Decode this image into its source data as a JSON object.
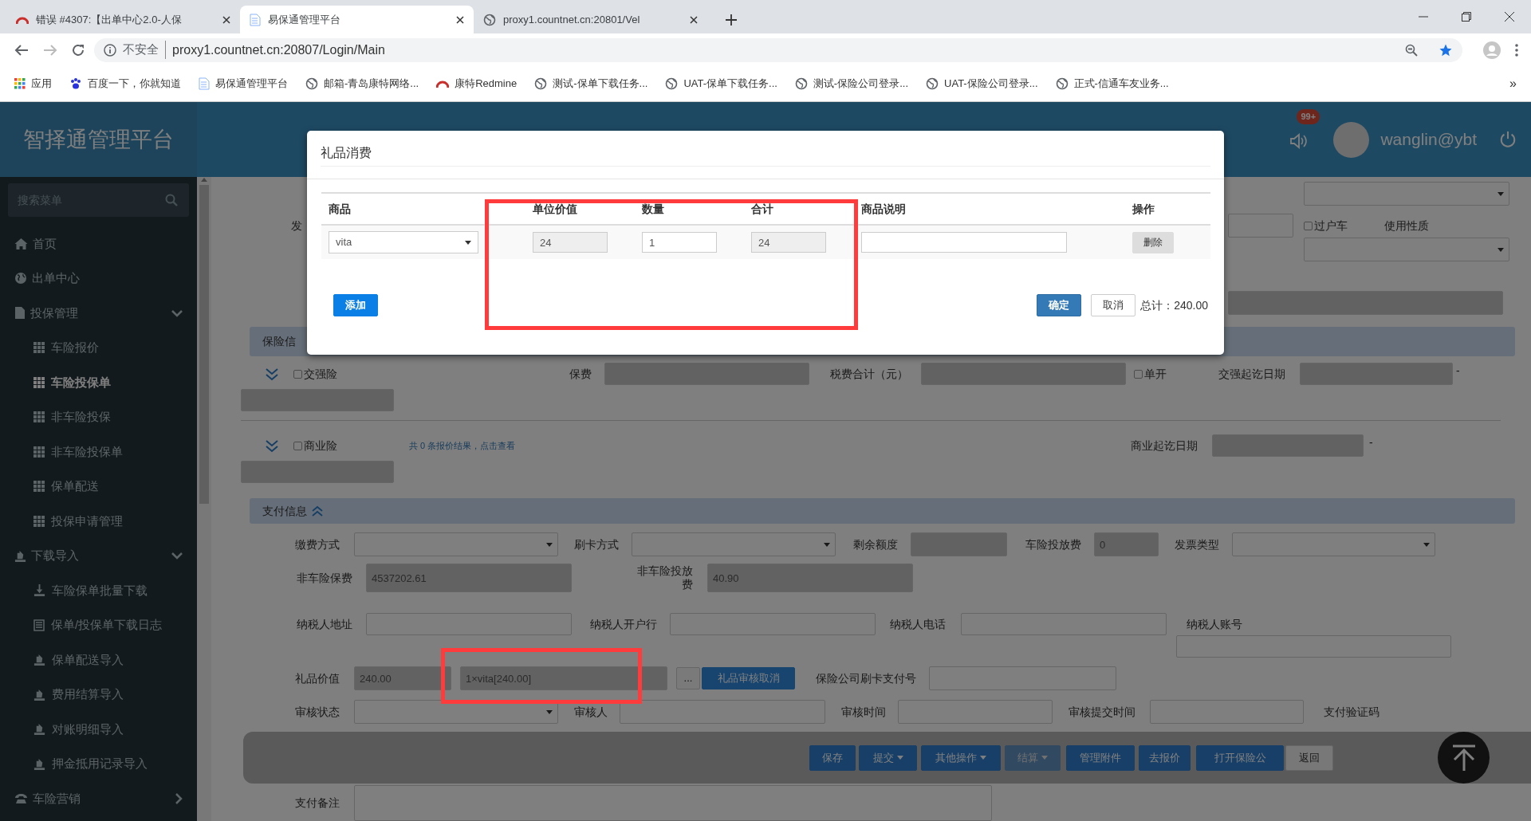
{
  "browser": {
    "tabs": [
      {
        "title": "错误 #4307:【出单中心2.0-人保",
        "selected": false
      },
      {
        "title": "易保通管理平台",
        "selected": true
      },
      {
        "title": "proxy1.countnet.cn:20801/Vel",
        "selected": false
      }
    ],
    "security": "不安全",
    "url": "proxy1.countnet.cn:20807/Login/Main",
    "bookmarks": [
      "应用",
      "百度一下，你就知道",
      "易保通管理平台",
      "邮箱-青岛康特网络...",
      "康特Redmine",
      "测试-保单下载任务...",
      "UAT-保单下载任务...",
      "测试-保险公司登录...",
      "UAT-保险公司登录...",
      "正式-信通车友业务..."
    ],
    "bookmarks_more": "»"
  },
  "header": {
    "title": "智择通管理平台",
    "badge": "99+",
    "user": "wanglin@ybt"
  },
  "sidebar": {
    "search": {
      "placeholder": "搜索菜单"
    },
    "items": [
      {
        "label": "首页",
        "selected": false
      },
      {
        "label": "出单中心",
        "selected": false
      },
      {
        "label": "投保管理",
        "selected": false,
        "expanded": true,
        "children": [
          {
            "label": "车险报价",
            "selected": false
          },
          {
            "label": "车险投保单",
            "selected": true
          },
          {
            "label": "非车险投保",
            "selected": false
          },
          {
            "label": "非车险投保单",
            "selected": false
          },
          {
            "label": "保单配送",
            "selected": false
          },
          {
            "label": "投保申请管理",
            "selected": false
          }
        ]
      },
      {
        "label": "下载导入",
        "selected": false,
        "expanded": true,
        "children": [
          {
            "label": "车险保单批量下载",
            "selected": false
          },
          {
            "label": "保单/投保单下载日志",
            "selected": false
          },
          {
            "label": "保单配送导入",
            "selected": false
          },
          {
            "label": "费用结算导入",
            "selected": false
          },
          {
            "label": "对账明细导入",
            "selected": false
          },
          {
            "label": "押金抵用记录导入",
            "selected": false
          }
        ]
      },
      {
        "label": "车险营销",
        "selected": false,
        "expanded": false
      }
    ]
  },
  "form": {
    "rows": [
      {
        "kind": "fields",
        "items": [
          {
            "kind": "select"
          }
        ]
      },
      {
        "kind": "fields",
        "items": [
          {
            "kind": "label",
            "text": "发"
          },
          {
            "kind": "input",
            "readonly": false
          },
          {
            "kind": "checkbox",
            "label": "过户车",
            "checked": false
          },
          {
            "kind": "label",
            "text": "使用性质"
          }
        ]
      },
      {
        "kind": "fields",
        "items": [
          {
            "kind": "select"
          }
        ]
      },
      {
        "kind": "fields",
        "items": [
          {
            "kind": "input",
            "readonly": true
          }
        ]
      },
      {
        "kind": "section",
        "title": "保险信"
      },
      {
        "kind": "fields",
        "items": [
          {
            "kind": "toggle"
          },
          {
            "kind": "checkbox",
            "label": "交强险",
            "checked": false
          },
          {
            "kind": "label",
            "text": "保费"
          },
          {
            "kind": "input",
            "readonly": true
          },
          {
            "kind": "label",
            "text": "税费合计（元）"
          },
          {
            "kind": "input",
            "readonly": true
          },
          {
            "kind": "checkbox",
            "label": "单开",
            "checked": false
          },
          {
            "kind": "label",
            "text": "交强起讫日期"
          },
          {
            "kind": "input",
            "readonly": true
          },
          {
            "kind": "text",
            "text": "-"
          }
        ]
      },
      {
        "kind": "fields",
        "items": [
          {
            "kind": "input",
            "readonly": true
          }
        ]
      },
      {
        "kind": "divider"
      },
      {
        "kind": "fields",
        "items": [
          {
            "kind": "toggle"
          },
          {
            "kind": "checkbox",
            "label": "商业险",
            "checked": false
          },
          {
            "kind": "link",
            "text": "共 0 条报价结果，点击查看"
          },
          {
            "kind": "label",
            "text": "商业起讫日期"
          },
          {
            "kind": "input",
            "readonly": true
          },
          {
            "kind": "text",
            "text": "-"
          }
        ]
      },
      {
        "kind": "fields",
        "items": [
          {
            "kind": "input",
            "readonly": true
          }
        ]
      },
      {
        "kind": "section",
        "title": "支付信息",
        "expanded": true
      },
      {
        "kind": "fields",
        "items": [
          {
            "kind": "label",
            "text": "缴费方式"
          },
          {
            "kind": "select"
          },
          {
            "kind": "label",
            "text": "刷卡方式"
          },
          {
            "kind": "select"
          },
          {
            "kind": "label",
            "text": "剩余额度"
          },
          {
            "kind": "input",
            "readonly": true
          },
          {
            "kind": "label",
            "text": "车险投放费"
          },
          {
            "kind": "input",
            "readonly": true,
            "value": "0"
          },
          {
            "kind": "label",
            "text": "发票类型"
          },
          {
            "kind": "select"
          }
        ]
      },
      {
        "kind": "fields",
        "items": [
          {
            "kind": "label",
            "text": "非车险保费"
          },
          {
            "kind": "input",
            "readonly": true,
            "value": "4537202.61"
          },
          {
            "kind": "label",
            "text": "非车险投放费"
          },
          {
            "kind": "input",
            "readonly": true,
            "value": "40.90"
          }
        ]
      },
      {
        "kind": "fields",
        "items": [
          {
            "kind": "label",
            "text": "纳税人地址"
          },
          {
            "kind": "input",
            "readonly": false
          },
          {
            "kind": "label",
            "text": "纳税人开户行"
          },
          {
            "kind": "input",
            "readonly": false
          },
          {
            "kind": "label",
            "text": "纳税人电话"
          },
          {
            "kind": "input",
            "readonly": false
          },
          {
            "kind": "label",
            "text": "纳税人账号"
          }
        ]
      },
      {
        "kind": "fields",
        "items": [
          {
            "kind": "input",
            "readonly": false
          }
        ]
      },
      {
        "kind": "fields",
        "items": [
          {
            "kind": "label",
            "text": "礼品价值"
          },
          {
            "kind": "input",
            "readonly": true,
            "value": "240.00"
          },
          {
            "kind": "input",
            "readonly": true,
            "value": "1×vita[240.00]"
          },
          {
            "kind": "button",
            "text": "...",
            "primary": false
          },
          {
            "kind": "button",
            "text": "礼品审核取消",
            "primary": true
          },
          {
            "kind": "label",
            "text": "保险公司刷卡支付号"
          },
          {
            "kind": "input",
            "readonly": false
          }
        ]
      },
      {
        "kind": "fields",
        "items": [
          {
            "kind": "label",
            "text": "审核状态"
          },
          {
            "kind": "select"
          },
          {
            "kind": "label",
            "text": "审核人"
          },
          {
            "kind": "input",
            "readonly": false
          },
          {
            "kind": "label",
            "text": "审核时间"
          },
          {
            "kind": "input",
            "readonly": false
          },
          {
            "kind": "label",
            "text": "审核提交时间"
          },
          {
            "kind": "input",
            "readonly": false
          },
          {
            "kind": "label",
            "text": "支付验证码"
          }
        ]
      },
      {
        "kind": "toolbar",
        "buttons": [
          {
            "label": "保存",
            "caret": false,
            "primary": true,
            "disabled": false
          },
          {
            "label": "提交",
            "caret": true,
            "primary": true,
            "disabled": false
          },
          {
            "label": "其他操作",
            "caret": true,
            "primary": true,
            "disabled": false
          },
          {
            "label": "结算",
            "caret": true,
            "primary": true,
            "disabled": true
          },
          {
            "label": "管理附件",
            "caret": false,
            "primary": true,
            "disabled": false
          },
          {
            "label": "去报价",
            "caret": false,
            "primary": true,
            "disabled": false
          },
          {
            "label": "打开保险公",
            "caret": false,
            "primary": true,
            "disabled": false
          },
          {
            "label": "返回",
            "caret": false,
            "primary": false,
            "disabled": false
          }
        ]
      },
      {
        "kind": "fields",
        "items": [
          {
            "kind": "label",
            "text": "支付备注"
          },
          {
            "kind": "textarea"
          }
        ]
      }
    ]
  },
  "modal": {
    "title": "礼品消费",
    "columns": [
      "商品",
      "单位价值",
      "数量",
      "合计",
      "商品说明",
      "操作"
    ],
    "rows": [
      {
        "product": "vita",
        "unit_value": "24",
        "quantity": "1",
        "total": "24",
        "action": "删除"
      }
    ],
    "add_button": "添加",
    "confirm_button": "确定",
    "cancel_button": "取消",
    "total": "总计：240.00"
  }
}
